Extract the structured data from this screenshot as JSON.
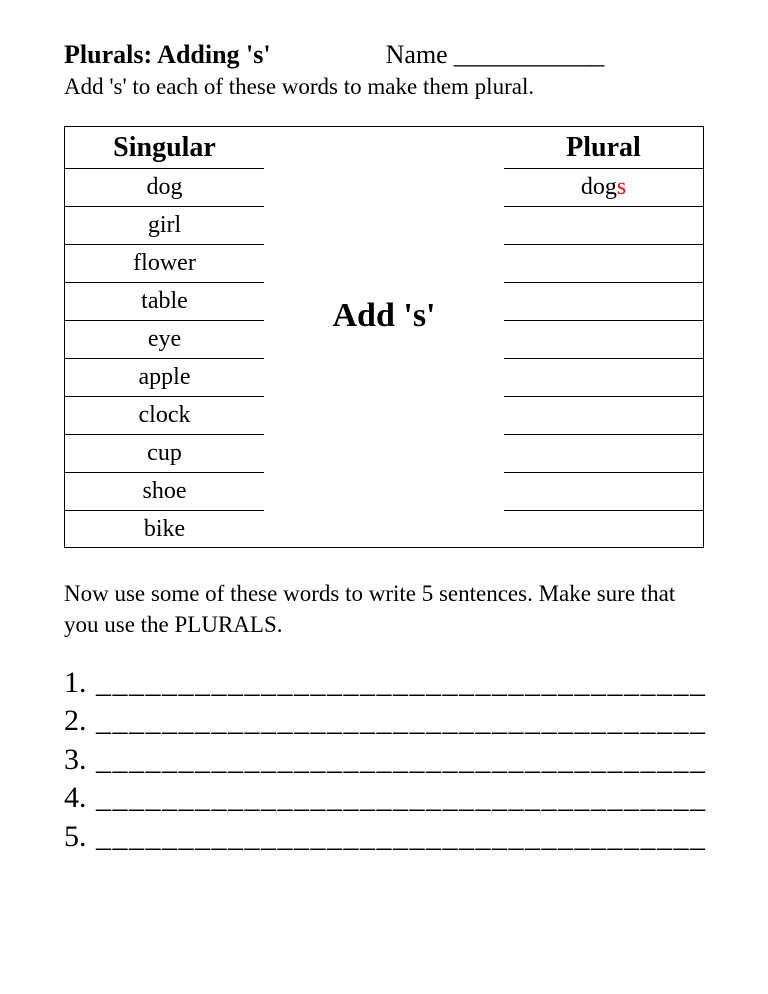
{
  "title": "Plurals:  Adding 's'",
  "name_label": "Name",
  "name_blank": "____________",
  "instruction1": "Add 's' to each of these words to make them plural.",
  "singular_header": "Singular",
  "plural_header": "Plural",
  "mid_label": "Add 's'",
  "singular_words": [
    "dog",
    "girl",
    "flower",
    "table",
    "eye",
    "apple",
    "clock",
    "cup",
    "shoe",
    "bike"
  ],
  "plural_example_base": "dog",
  "plural_example_suffix": "s",
  "instruction2": "Now use some of these words to write 5 sentences. Make sure that you use the PLURALS.",
  "sentence_numbers": [
    "1.",
    "2.",
    "3.",
    "4.",
    "5."
  ],
  "sentence_blank": "_____________________________________"
}
